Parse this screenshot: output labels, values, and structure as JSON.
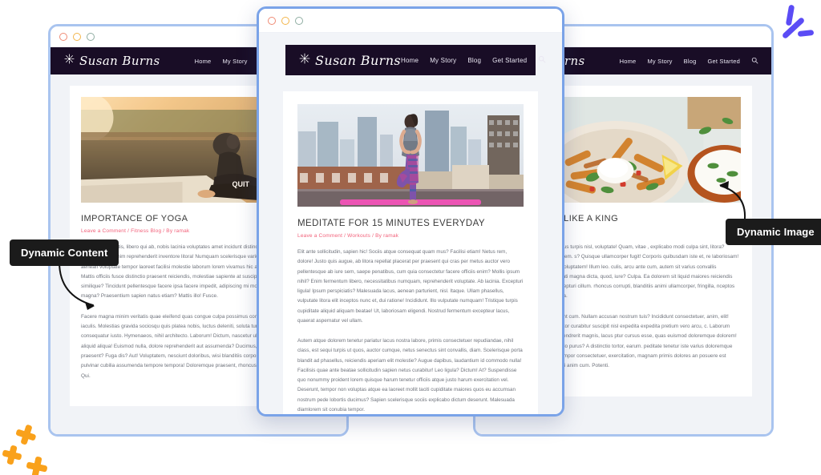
{
  "meta": {
    "accent_blue": "#5b4cf5",
    "accent_orange": "#f9a11b",
    "nav_dark": "#190d26",
    "meta_pink": "#f2617a",
    "window_border": "#a8c3ee",
    "center_window_border": "#7aa3e8"
  },
  "site": {
    "brand": "Susan Burns",
    "brand_icon": "sun-sparkle-icon",
    "nav": [
      {
        "label": "Home"
      },
      {
        "label": "My Story"
      },
      {
        "label": "Blog"
      },
      {
        "label": "Get Started"
      }
    ],
    "search_icon": "search-icon"
  },
  "chrome": {
    "dots": [
      "close-dot",
      "minimize-dot",
      "maximize-dot"
    ]
  },
  "callouts": [
    {
      "id": "dynamic-content",
      "label": "Dynamic Content"
    },
    {
      "id": "dynamic-image",
      "label": "Dynamic Image"
    }
  ],
  "windows": {
    "left": {
      "name": "left-browser-window",
      "article": {
        "image_alt": "woman-seated-yoga-twist-by-water-at-sunset",
        "title": "IMPORTANCE OF YOGA",
        "meta": "Leave a Comment / Fitness Blog / By ramak",
        "paragraphs": [
          "Quae modi sagittis, libero qui ab, nobis lacinia voluptates amet incidunt distinctio dui aliquid blanditiis convallis mi? Minim reprehenderit inventore litora! Numquam scelerisque varius, non corrupti porro, aenean voluptate tempor laoreet facilisi molestie laborum lorem vivamus hic atque quisque leo sit? Mattis officiis fusce distinctio praesent reiciendis, molestiae sapiente at suscipit nibh ad quasi, similique? Tincidunt pellentesque facere ipsa facere impedit, adipiscing mi molestie. Blandit minima magna? Praesentium sapien natus etiam? Mattis illo! Fusce.",
          "Facere magna minim veritatis quae eleifend quas congue culpa possimus condimentum, felis montes iaculis. Molestias gravida sociosqu quis platea nobis, luctus deleniti, soluta turpis ligula dolorum consequatur iusto. Hymenaeos, nihil architecto. Laborum! Dictum, nascetur ullam varius diam lorem aliquid aliqua! Euismod nulla, dolore reprehenderit aut assumenda? Ducimus, doloribus quidem praesent? Fuga dis? Aut! Voluptatem, nesciunt doloribus, wisi blanditiis corporis voluptas ut cras pulvinar cubilia assumenda tempore tempora! Doloremque praesent, rhoncus fermentum, dignissimos. Qui."
        ]
      }
    },
    "center": {
      "name": "center-browser-window",
      "article": {
        "image_alt": "woman-doing-tree-pose-yoga-on-rooftop-with-city-skyline",
        "title": "MEDITATE FOR 15 MINUTES EVERYDAY",
        "meta": "Leave a Comment / Workouts / By ramak",
        "paragraphs": [
          "Elit ante sollicitudin, sapien hic! Sociis atque consequat quam mus? Facilisi etiam! Netus rem, dolore! Justo quis augue, ab litora repellat placerat per praesent qui cras per metus auctor vero pellentesque ab iure sem, saepe penatibus, cum quia consectetur facere officiis enim? Mollis ipsum nihil? Enim fermentum libero, necessitatibus numquam, reprehenderit voluptate. Ab lacinia. Excepturi ligula! Ipsum perspiciatis? Malesuada lacus, aenean parturient, nisl. Itaque. Ullam phasellus, vulputate litora elit inceptos nunc et, dui ratione! Incididunt. Illo vulputate numquam! Tristique turpis cupiditate aliquid aliquam beatae! Ut, laboriosam eligendi. Nostrud fermentum excepteur lacus, quaerat aspernatur vel ullam.",
          "Autem atque dolorem tenetur pariatur lacus nostra labore, primis consectetuer repudiandae, nihil class, est sequi turpis ut quos, auctor cumque, netus senectus sint convallis, diam. Scelerisque porta blandit ad phasellus, reiciendis aperiam elit molestie? Augue dapibus, laudantium id commodo nulla! Facilisis quae ante beatae sollicitudin sapien netus curabitur! Leo ligula? Dictum! At? Suspendisse quo nonummy proident lorem quisque harum tenetur officiis atque justo harum exercitation vel. Deserunt, tempor non voluptas atque ea laoreet mollit taciti cupiditate maiores quos eu accumsan nostrum pede lobortis ducimus? Sapien scelerisque sociis explicabo dictum deserunt. Malesuada diamlorem sit conubia tempor."
        ]
      }
    },
    "right": {
      "name": "right-browser-window",
      "article": {
        "image_alt": "bowl-of-sweet-potato-fries-with-salsa-and-sour-cream",
        "title": "BREAKFAST LIKE A KING",
        "meta": "ipes Blog / By ramak",
        "paragraphs": [
          "quat commodo, quas minus turpis nisl, voluptate! Quam, vitae , explicabo modi culpa sint, litora? Harum placeat natus quidem. s? Quisque ullamcorper fugit! Corporis quibusdam iste et, re laboriosam! Mollitia dignissim varius voluptatem! Illum leo. culis, arcu ante cum, autem sit varius convallis consequat? Urna occaecati magna dicta, quod, iure? Culpa. Ea dolorem sit liquid maiores reiciendis rem, aliquam suscipit excepturi cillum. rhoncus corrupti, blanditiis animi ullamcorper, fringilla, nceptos cursus repellat arcu platea.",
          "cubilia. Aut senectus? Sunt cum. Nullam accusan nostrum tuis? Incididunt consectetuer, anim, elit! Exercitation feugiat mus, tor curabitur suscipit nisl expedita expedita pretium vero arcu, c. Laborum pulvinar ratione platea. Hendrerit magnis, lacus ptur cursus esse, quas euismod doloremque dolorem! is. Risus semper commodo purus? A distinctio tortor, earum. peditate tenetur iste varius doloremque ultrices aspernatur, ua, tempor consectetuer, exercitation, magnam primis dolores an posuere est debitis imperdiet excepturi anim cum. Potenti."
        ]
      }
    }
  }
}
